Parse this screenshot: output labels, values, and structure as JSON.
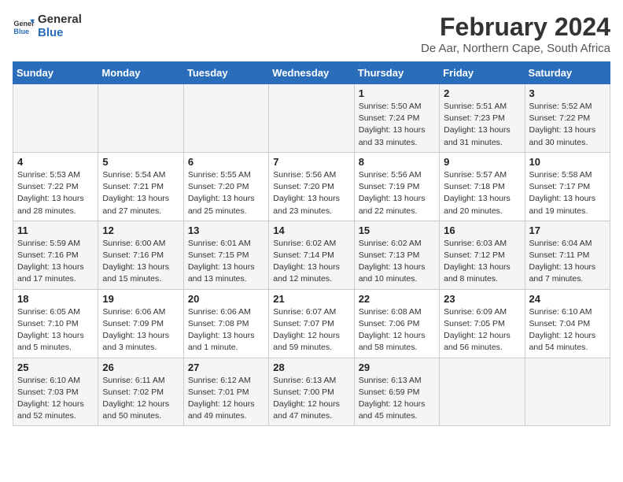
{
  "logo": {
    "line1": "General",
    "line2": "Blue"
  },
  "title": "February 2024",
  "subtitle": "De Aar, Northern Cape, South Africa",
  "headers": [
    "Sunday",
    "Monday",
    "Tuesday",
    "Wednesday",
    "Thursday",
    "Friday",
    "Saturday"
  ],
  "weeks": [
    [
      {
        "day": "",
        "info": ""
      },
      {
        "day": "",
        "info": ""
      },
      {
        "day": "",
        "info": ""
      },
      {
        "day": "",
        "info": ""
      },
      {
        "day": "1",
        "info": "Sunrise: 5:50 AM\nSunset: 7:24 PM\nDaylight: 13 hours\nand 33 minutes."
      },
      {
        "day": "2",
        "info": "Sunrise: 5:51 AM\nSunset: 7:23 PM\nDaylight: 13 hours\nand 31 minutes."
      },
      {
        "day": "3",
        "info": "Sunrise: 5:52 AM\nSunset: 7:22 PM\nDaylight: 13 hours\nand 30 minutes."
      }
    ],
    [
      {
        "day": "4",
        "info": "Sunrise: 5:53 AM\nSunset: 7:22 PM\nDaylight: 13 hours\nand 28 minutes."
      },
      {
        "day": "5",
        "info": "Sunrise: 5:54 AM\nSunset: 7:21 PM\nDaylight: 13 hours\nand 27 minutes."
      },
      {
        "day": "6",
        "info": "Sunrise: 5:55 AM\nSunset: 7:20 PM\nDaylight: 13 hours\nand 25 minutes."
      },
      {
        "day": "7",
        "info": "Sunrise: 5:56 AM\nSunset: 7:20 PM\nDaylight: 13 hours\nand 23 minutes."
      },
      {
        "day": "8",
        "info": "Sunrise: 5:56 AM\nSunset: 7:19 PM\nDaylight: 13 hours\nand 22 minutes."
      },
      {
        "day": "9",
        "info": "Sunrise: 5:57 AM\nSunset: 7:18 PM\nDaylight: 13 hours\nand 20 minutes."
      },
      {
        "day": "10",
        "info": "Sunrise: 5:58 AM\nSunset: 7:17 PM\nDaylight: 13 hours\nand 19 minutes."
      }
    ],
    [
      {
        "day": "11",
        "info": "Sunrise: 5:59 AM\nSunset: 7:16 PM\nDaylight: 13 hours\nand 17 minutes."
      },
      {
        "day": "12",
        "info": "Sunrise: 6:00 AM\nSunset: 7:16 PM\nDaylight: 13 hours\nand 15 minutes."
      },
      {
        "day": "13",
        "info": "Sunrise: 6:01 AM\nSunset: 7:15 PM\nDaylight: 13 hours\nand 13 minutes."
      },
      {
        "day": "14",
        "info": "Sunrise: 6:02 AM\nSunset: 7:14 PM\nDaylight: 13 hours\nand 12 minutes."
      },
      {
        "day": "15",
        "info": "Sunrise: 6:02 AM\nSunset: 7:13 PM\nDaylight: 13 hours\nand 10 minutes."
      },
      {
        "day": "16",
        "info": "Sunrise: 6:03 AM\nSunset: 7:12 PM\nDaylight: 13 hours\nand 8 minutes."
      },
      {
        "day": "17",
        "info": "Sunrise: 6:04 AM\nSunset: 7:11 PM\nDaylight: 13 hours\nand 7 minutes."
      }
    ],
    [
      {
        "day": "18",
        "info": "Sunrise: 6:05 AM\nSunset: 7:10 PM\nDaylight: 13 hours\nand 5 minutes."
      },
      {
        "day": "19",
        "info": "Sunrise: 6:06 AM\nSunset: 7:09 PM\nDaylight: 13 hours\nand 3 minutes."
      },
      {
        "day": "20",
        "info": "Sunrise: 6:06 AM\nSunset: 7:08 PM\nDaylight: 13 hours\nand 1 minute."
      },
      {
        "day": "21",
        "info": "Sunrise: 6:07 AM\nSunset: 7:07 PM\nDaylight: 12 hours\nand 59 minutes."
      },
      {
        "day": "22",
        "info": "Sunrise: 6:08 AM\nSunset: 7:06 PM\nDaylight: 12 hours\nand 58 minutes."
      },
      {
        "day": "23",
        "info": "Sunrise: 6:09 AM\nSunset: 7:05 PM\nDaylight: 12 hours\nand 56 minutes."
      },
      {
        "day": "24",
        "info": "Sunrise: 6:10 AM\nSunset: 7:04 PM\nDaylight: 12 hours\nand 54 minutes."
      }
    ],
    [
      {
        "day": "25",
        "info": "Sunrise: 6:10 AM\nSunset: 7:03 PM\nDaylight: 12 hours\nand 52 minutes."
      },
      {
        "day": "26",
        "info": "Sunrise: 6:11 AM\nSunset: 7:02 PM\nDaylight: 12 hours\nand 50 minutes."
      },
      {
        "day": "27",
        "info": "Sunrise: 6:12 AM\nSunset: 7:01 PM\nDaylight: 12 hours\nand 49 minutes."
      },
      {
        "day": "28",
        "info": "Sunrise: 6:13 AM\nSunset: 7:00 PM\nDaylight: 12 hours\nand 47 minutes."
      },
      {
        "day": "29",
        "info": "Sunrise: 6:13 AM\nSunset: 6:59 PM\nDaylight: 12 hours\nand 45 minutes."
      },
      {
        "day": "",
        "info": ""
      },
      {
        "day": "",
        "info": ""
      }
    ]
  ]
}
